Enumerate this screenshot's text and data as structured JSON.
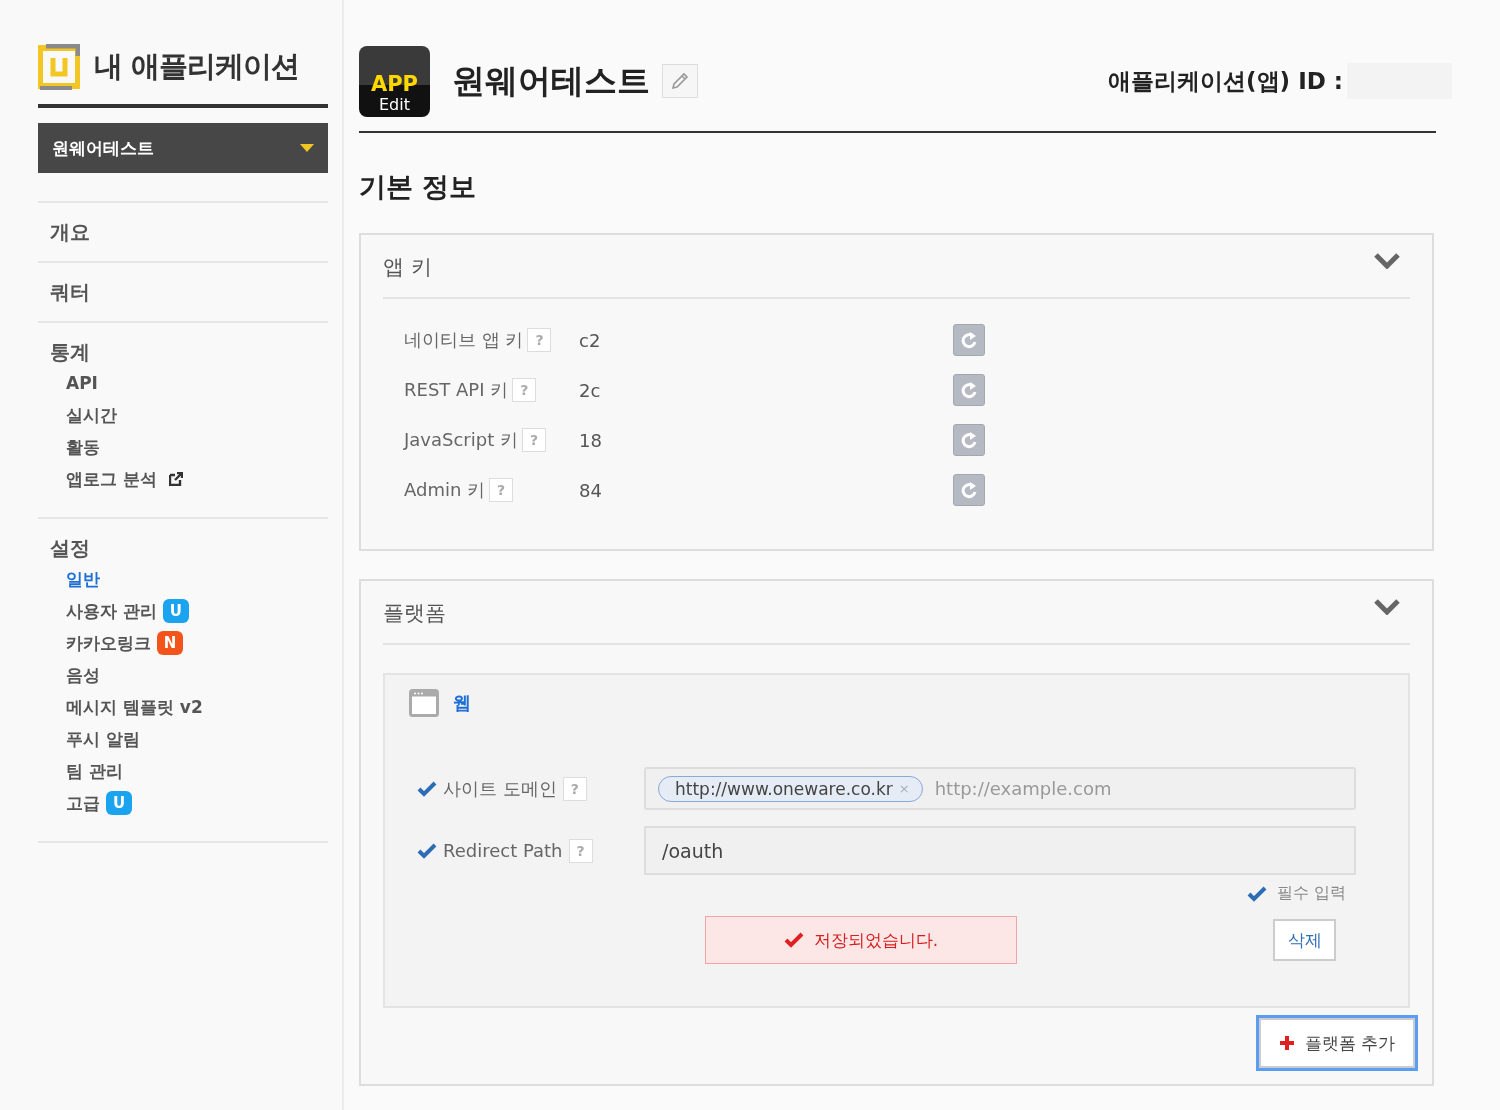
{
  "sidebar": {
    "title": "내 애플리케이션",
    "app_select": {
      "value": "원웨어테스트"
    },
    "groups": [
      {
        "label": "개요"
      },
      {
        "label": "쿼터"
      },
      {
        "label": "통계",
        "items": [
          {
            "label": "API",
            "selected": false
          },
          {
            "label": "실시간",
            "selected": false
          },
          {
            "label": "활동",
            "selected": false
          },
          {
            "label": "앱로그 분석",
            "selected": false,
            "external": true
          }
        ]
      },
      {
        "label": "설정",
        "items": [
          {
            "label": "일반",
            "selected": true
          },
          {
            "label": "사용자 관리",
            "selected": false,
            "badge": {
              "text": "U",
              "color": "#1aa3ef"
            }
          },
          {
            "label": "카카오링크",
            "selected": false,
            "badge": {
              "text": "N",
              "color": "#f2541b"
            }
          },
          {
            "label": "음성",
            "selected": false
          },
          {
            "label": "메시지 템플릿 v2",
            "selected": false
          },
          {
            "label": "푸시 알림",
            "selected": false
          },
          {
            "label": "팀 관리",
            "selected": false
          },
          {
            "label": "고급",
            "selected": false,
            "badge": {
              "text": "U",
              "color": "#1aa3ef"
            }
          }
        ]
      }
    ]
  },
  "header": {
    "icon_text": "APP",
    "icon_caption": "Edit",
    "app_name": "원웨어테스트",
    "id_label": "애플리케이션(앱) ID :"
  },
  "section_title": "기본 정보",
  "app_keys": {
    "title": "앱 키",
    "expanded": true,
    "rows": [
      {
        "label": "네이티브 앱 키",
        "help": "?",
        "value": "c2"
      },
      {
        "label": "REST API 키",
        "help": "?",
        "value": "2c"
      },
      {
        "label": "JavaScript 키",
        "help": "?",
        "value": "18"
      },
      {
        "label": "Admin 키",
        "help": "?",
        "value": "84"
      }
    ]
  },
  "platform": {
    "title": "플랫폼",
    "expanded": true,
    "card": {
      "name": "웹",
      "fields": [
        {
          "kind": "tags",
          "label": "사이트 도메인",
          "help": "?",
          "required": true,
          "tags": [
            "http://www.oneware.co.kr"
          ],
          "tag_remove": "×",
          "placeholder": "http://example.com"
        },
        {
          "kind": "text",
          "label": "Redirect Path",
          "help": "?",
          "required": true,
          "value": "/oauth"
        }
      ],
      "required_note": "필수 입력",
      "message": "저장되었습니다.",
      "delete_button": "삭제"
    },
    "add_button": {
      "label": "플랫폼 추가",
      "focused": true
    }
  }
}
